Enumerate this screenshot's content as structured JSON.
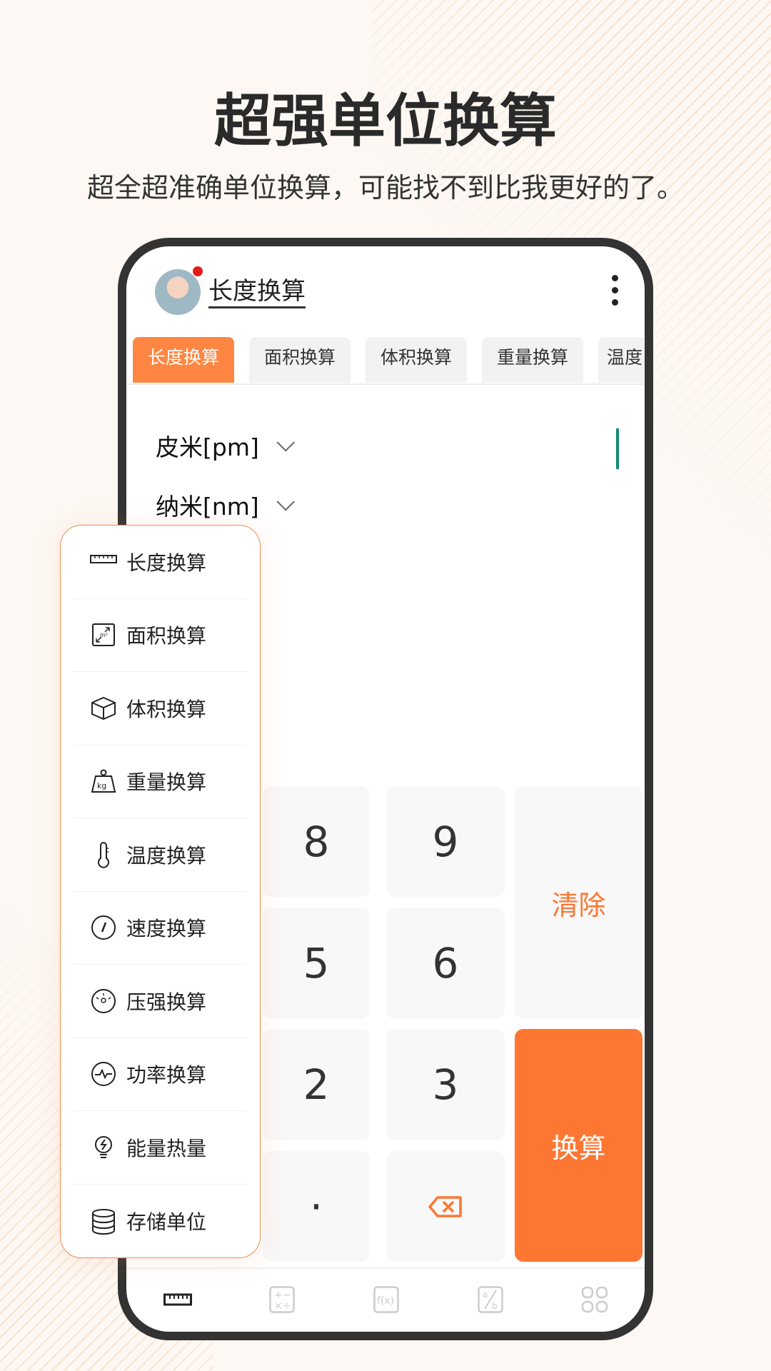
{
  "headline": "超强单位换算",
  "subtitle": "超全超准确单位换算，可能找不到比我更好的了。",
  "app": {
    "title": "长度换算",
    "tabs": [
      "长度换算",
      "面积换算",
      "体积换算",
      "重量换算",
      "温度"
    ],
    "from_unit": "皮米[pm]",
    "to_unit": "纳米[nm]"
  },
  "keypad": {
    "keys": [
      "8",
      "9",
      "5",
      "6",
      "2",
      "3",
      "·"
    ],
    "clear": "清除",
    "convert": "换算",
    "backspace_icon": "backspace-icon"
  },
  "menu": {
    "items": [
      {
        "label": "长度换算",
        "icon": "ruler-icon"
      },
      {
        "label": "面积换算",
        "icon": "area-icon"
      },
      {
        "label": "体积换算",
        "icon": "cube-icon"
      },
      {
        "label": "重量换算",
        "icon": "weight-icon"
      },
      {
        "label": "温度换算",
        "icon": "thermometer-icon"
      },
      {
        "label": "速度换算",
        "icon": "speedometer-icon"
      },
      {
        "label": "压强换算",
        "icon": "gauge-icon"
      },
      {
        "label": "功率换算",
        "icon": "pulse-icon"
      },
      {
        "label": "能量热量",
        "icon": "bulb-icon"
      },
      {
        "label": "存储单位",
        "icon": "database-icon"
      }
    ]
  },
  "bottom_nav": [
    "ruler-icon",
    "calculator-icon",
    "function-icon",
    "fraction-icon",
    "grid-icon"
  ],
  "colors": {
    "accent": "#fd7733",
    "tab_active": "#fd8642",
    "cursor": "#0e8a75",
    "background": "#fdf8f3"
  }
}
